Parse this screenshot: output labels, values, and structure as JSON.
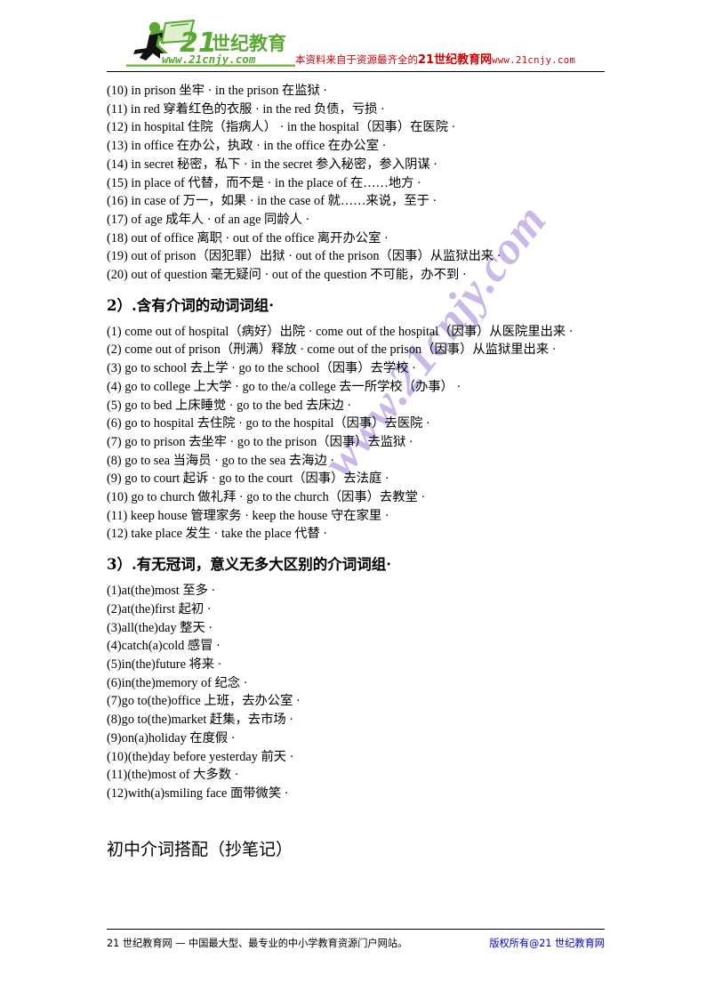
{
  "header": {
    "logo": {
      "brand_cn": "21世纪教育",
      "brand_url": "www.21cnjy.com",
      "number": "21",
      "alt": "21-century-education-logo"
    },
    "note_prefix": "本资料来自于资源最齐全的",
    "note_big": "21世纪教育网",
    "note_url": "www.21cnjy.com"
  },
  "watermark": {
    "text": "www.21cnjy.com",
    "color": "#c9b8e8"
  },
  "content": {
    "group1_lines": [
      "(10) in prison 坐牢 · in the prison 在监狱  ·",
      "(11) in red 穿着红色的衣服 · in the red 负债，亏损  ·",
      "(12) in hospital 住院（指病人） · in the hospital（因事）在医院  ·",
      "(13) in office 在办公，执政 · in the office 在办公室  ·",
      "(14) in secret 秘密，私下 · in the secret 参入秘密，参入阴谋  ·",
      "(15) in place of  代替，而不是 · in the place of 在……地方  ·",
      "(16) in case of 万一，如果 · in the case of 就……来说，至于  ·",
      "(17) of age 成年人 · of an age 同龄人  ·",
      "(18) out of office 离职 · out of the office 离开办公室  ·",
      "(19) out of prison（因犯罪）出狱 · out of the prison（因事）从监狱出来  ·",
      "(20) out of question 毫无疑问 · out of the question 不可能，办不到  ·"
    ],
    "section2_heading": "2）.含有介词的动词词组·",
    "group2_lines": [
      "(1) come out of hospital（病好）出院 · come out of the hospital（因事）从医院里出来  ·",
      "(2) come out of prison（刑满）释放 · come out of the prison（因事）从监狱里出来  ·",
      "(3) go to school 去上学 · go to the school（因事）去学校 ·",
      "(4) go to college 上大学 · go to the/a college 去一所学校（办事）   ·",
      "(5) go to bed 上床睡觉 · go to the bed 去床边  ·",
      "(6) go to hospital 去住院 · go to the hospital（因事）去医院  ·",
      "(7) go to prison 去坐牢 · go to the prison（因事）去监狱  ·",
      "(8) go to sea 当海员 · go to the sea 去海边  ·",
      "(9) go to court 起诉 · go to the court（因事）去法庭  ·",
      "(10) go to church 做礼拜 ·  go to the church（因事）去教堂  ·",
      "(11) keep house 管理家务 · keep the house 守在家里  ·",
      "(12) take place 发生 ·        take the place 代替  ·"
    ],
    "section3_heading": "3）.有无冠词，意义无多大区别的介词词组·",
    "group3_lines": [
      "(1)at(the)most 至多 ·",
      "(2)at(the)first 起初 ·",
      "(3)all(the)day  整天 ·",
      "(4)catch(a)cold 感冒 ·",
      "(5)in(the)future  将来 ·",
      "(6)in(the)memory  of 纪念 ·",
      "(7)go to(the)office  上班，去办公室 ·",
      "(8)go to(the)market  赶集，去市场 ·",
      "(9)on(a)holiday  在度假 ·",
      "(10)(the)day before yesterday  前天 ·",
      "(11)(the)most of  大多数 ·",
      "(12)with(a)smiling face  面带微笑 ·"
    ],
    "final_title": "初中介词搭配（抄笔记）"
  },
  "footer": {
    "left": "21 世纪教育网 — 中国最大型、最专业的中小学教育资源门户网站。",
    "right": "版权所有@21 世纪教育网"
  }
}
